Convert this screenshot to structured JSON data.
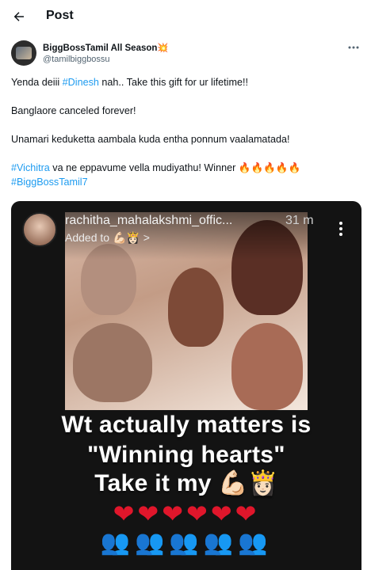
{
  "header": {
    "title": "Post"
  },
  "author": {
    "display_name": "BiggBossTamil All Season",
    "badge": "💥",
    "handle": "@tamilbiggbossu"
  },
  "tweet": {
    "line1_pre": "Yenda deiii ",
    "line1_tag": "#Dinesh",
    "line1_post": " nah.. Take this gift for ur lifetime!!",
    "line2": "Banglaore canceled forever!",
    "line3": "Unamari keduketta aambala kuda entha ponnum vaalamatada!",
    "line4_tag": "#Vichitra",
    "line4_post": " va ne eppavume vella mudiyathu! Winner ",
    "line4_emoji": "🔥🔥🔥🔥🔥",
    "line5_tag": "#BiggBossTamil7"
  },
  "media": {
    "story_username": "rachitha_mahalakshmi_offic...",
    "story_time": "31 m",
    "story_added": "Added to 💪🏻👸🏻 >",
    "caption_line1": "Wt actually matters is",
    "caption_line2": "\"Winning hearts\"",
    "caption_line3": "Take it my 💪🏻👸🏻",
    "hearts": "❤❤❤❤❤❤",
    "people": "👥👥👥👥👥"
  },
  "colors": {
    "link": "#1d9bf0",
    "muted": "#536471",
    "media_bg": "#131313"
  },
  "icons": {
    "back": "arrow-left-icon",
    "more": "more-horizontal-icon",
    "story_menu": "more-vertical-icon"
  }
}
